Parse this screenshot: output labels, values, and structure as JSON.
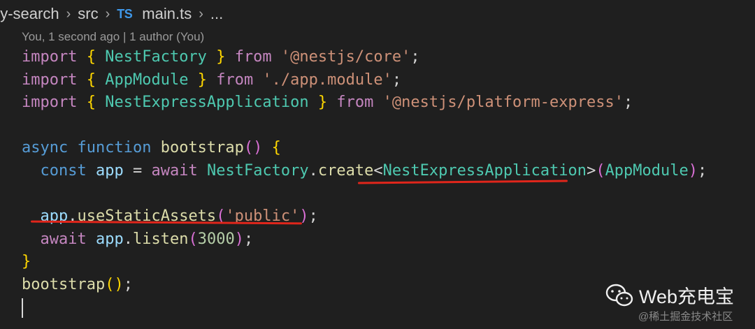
{
  "breadcrumb": {
    "items": [
      "py-search",
      "src"
    ],
    "file_icon": "TS",
    "file": "main.ts",
    "more": "..."
  },
  "blame": {
    "text": "You, 1 second ago | 1 author (You)"
  },
  "code": {
    "l1": {
      "import": "import",
      "open": "{",
      "name": "NestFactory",
      "close": "}",
      "from": "from",
      "path": "'@nestjs/core'",
      "semi": ";"
    },
    "l2": {
      "import": "import",
      "open": "{",
      "name": "AppModule",
      "close": "}",
      "from": "from",
      "path": "'./app.module'",
      "semi": ";"
    },
    "l3": {
      "import": "import",
      "open": "{",
      "name": "NestExpressApplication",
      "close": "}",
      "from": "from",
      "path": "'@nestjs/platform-express'",
      "semi": ";"
    },
    "l5": {
      "async": "async",
      "function": "function",
      "name": "bootstrap",
      "parens": "()",
      "brace": "{"
    },
    "l6": {
      "const": "const",
      "var": "app",
      "eq": "=",
      "await": "await",
      "obj": "NestFactory",
      "dot": ".",
      "method": "create",
      "lt": "<",
      "generic": "NestExpressApplication",
      "gt": ">",
      "po": "(",
      "arg": "AppModule",
      "pc": ")",
      "semi": ";"
    },
    "l8": {
      "var": "app",
      "dot": ".",
      "method": "useStaticAssets",
      "po": "(",
      "arg": "'public'",
      "pc": ")",
      "semi": ";"
    },
    "l9": {
      "await": "await",
      "var": "app",
      "dot": ".",
      "method": "listen",
      "po": "(",
      "arg": "3000",
      "pc": ")",
      "semi": ";"
    },
    "l10": {
      "brace": "}"
    },
    "l11": {
      "name": "bootstrap",
      "parens": "()",
      "semi": ";"
    }
  },
  "watermark": {
    "title": "Web充电宝",
    "subtitle": "@稀土掘金技术社区"
  },
  "colors": {
    "underline": "#e0261b",
    "keyword": "#c586c0",
    "type": "#4ec9b0",
    "string": "#ce9178"
  }
}
